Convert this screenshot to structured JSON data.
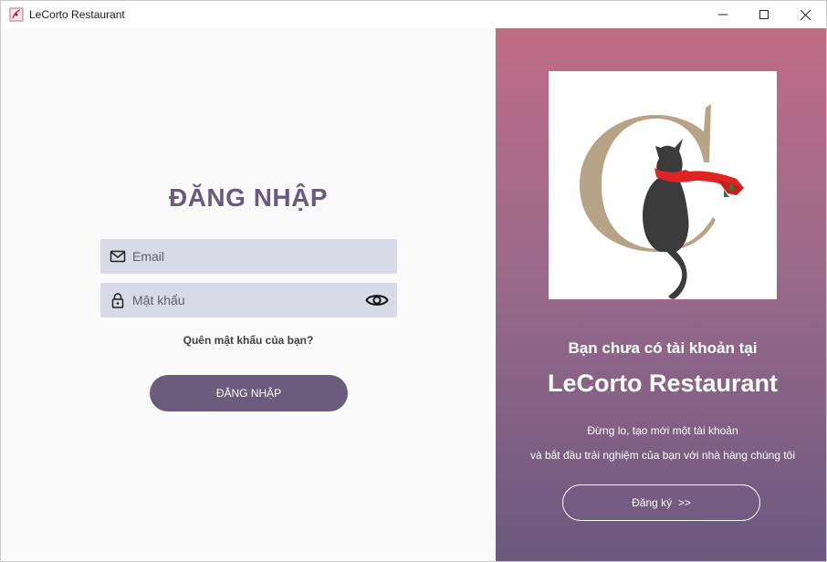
{
  "window": {
    "title": "LeCorto Restaurant",
    "icons": {
      "app": "app-logo-icon",
      "minimize": "minimize-icon",
      "maximize": "maximize-icon",
      "close": "close-icon"
    }
  },
  "login": {
    "title": "ĐĂNG NHẬP",
    "email_placeholder": "Email",
    "password_placeholder": "Mật khẩu",
    "forgot": "Quên mật khẩu của bạn?",
    "submit": "ĐĂNG NHẬP",
    "icons": {
      "email": "mail-icon",
      "password": "lock-icon",
      "toggle": "eye-icon"
    },
    "colors": {
      "title": "#6a5a82",
      "field_bg": "#d8dbe7",
      "button_bg": "#6b5c7e"
    }
  },
  "promo": {
    "line1": "Bạn chưa có tài khoản tại",
    "line2": "LeCorto Restaurant",
    "line3": "Đừng lo, tạo mới một tài khoản",
    "line4": "và bắt đầu trải nghiệm của bạn với nhà hàng chúng tôi",
    "signup": "Đăng ký  >>",
    "logo_icon": "cat-logo",
    "colors": {
      "gradient_top": "#c06c86",
      "gradient_bottom": "#6b587f"
    }
  }
}
